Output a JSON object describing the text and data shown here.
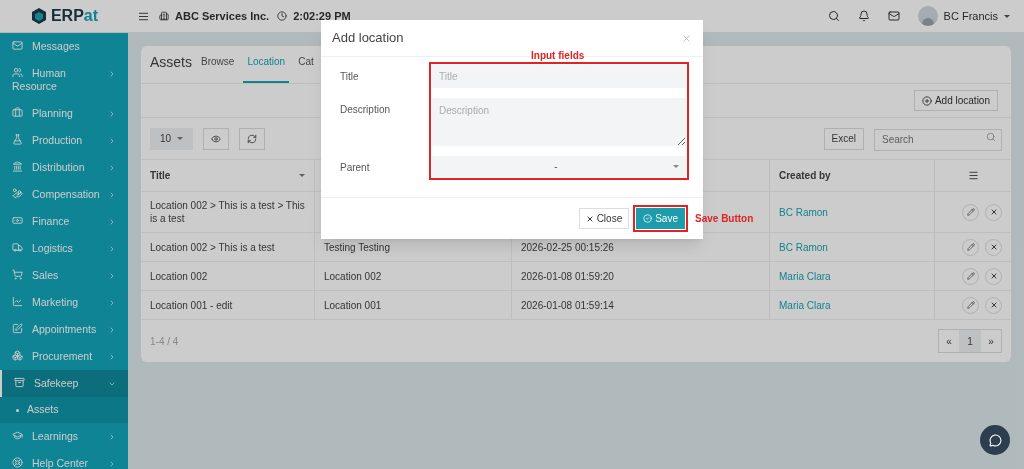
{
  "logo": {
    "main": "ERP",
    "accent": "at"
  },
  "topbar": {
    "company": "ABC Services Inc.",
    "time": "2:02:29 PM",
    "user": "BC Francis"
  },
  "sidebar": {
    "items": [
      {
        "label": "Messages",
        "has_children": false,
        "selected": false,
        "expanded": false
      },
      {
        "label": "Human Resource",
        "has_children": true,
        "selected": false,
        "expanded": false
      },
      {
        "label": "Planning",
        "has_children": true,
        "selected": false,
        "expanded": false
      },
      {
        "label": "Production",
        "has_children": true,
        "selected": false,
        "expanded": false
      },
      {
        "label": "Distribution",
        "has_children": true,
        "selected": false,
        "expanded": false
      },
      {
        "label": "Compensation",
        "has_children": true,
        "selected": false,
        "expanded": false
      },
      {
        "label": "Finance",
        "has_children": true,
        "selected": false,
        "expanded": false
      },
      {
        "label": "Logistics",
        "has_children": true,
        "selected": false,
        "expanded": false
      },
      {
        "label": "Sales",
        "has_children": true,
        "selected": false,
        "expanded": false
      },
      {
        "label": "Marketing",
        "has_children": true,
        "selected": false,
        "expanded": false
      },
      {
        "label": "Appointments",
        "has_children": true,
        "selected": false,
        "expanded": false
      },
      {
        "label": "Procurement",
        "has_children": true,
        "selected": false,
        "expanded": false
      },
      {
        "label": "Safekeep",
        "has_children": true,
        "selected": true,
        "expanded": true,
        "children": [
          {
            "label": "Assets",
            "selected": false
          }
        ]
      },
      {
        "label": "Learnings",
        "has_children": true,
        "selected": false,
        "expanded": false
      },
      {
        "label": "Help Center",
        "has_children": true,
        "selected": false,
        "expanded": false
      }
    ]
  },
  "card": {
    "title": "Assets",
    "tabs": [
      {
        "label": "Browse",
        "selected": false
      },
      {
        "label": "Location",
        "selected": true
      },
      {
        "label": "Cat",
        "selected": false
      }
    ],
    "add_button": "Add location",
    "page_size": "10",
    "excel_button": "Excel",
    "search": {
      "placeholder": "Search"
    },
    "table": {
      "header": {
        "title": "Title",
        "created_by": "Created by"
      },
      "rows": [
        {
          "title": "Location 002 > This is a test > This is a test",
          "created_by": "BC Ramon"
        },
        {
          "title": "Location 002 > This is a test",
          "column_2": "Testing Testing",
          "column_3": "2026-02-25 00:15:26",
          "created_by": "BC Ramon"
        },
        {
          "title": "Location 002",
          "column_2": "Location 002",
          "column_3": "2026-01-08 01:59:20",
          "created_by": "Maria Clara"
        },
        {
          "title": "Location 001 - edit",
          "column_2": "Location 001",
          "column_3": "2026-01-08 01:59:14",
          "created_by": "Maria Clara"
        }
      ]
    },
    "summary": "1-4 / 4",
    "pagination": {
      "prev": "«",
      "pages": [
        {
          "label": "1",
          "selected": true
        }
      ],
      "next": "»"
    }
  },
  "modal": {
    "title": "Add location",
    "fields": [
      {
        "kind": "text",
        "label": "Title",
        "placeholder": "Title"
      },
      {
        "kind": "textarea",
        "label": "Description",
        "placeholder": "Description"
      },
      {
        "kind": "select",
        "label": "Parent",
        "value": "-"
      }
    ],
    "close_button": "Close",
    "save_button": "Save"
  },
  "annotations": {
    "fields": "Input fields",
    "save": "Save Button"
  }
}
